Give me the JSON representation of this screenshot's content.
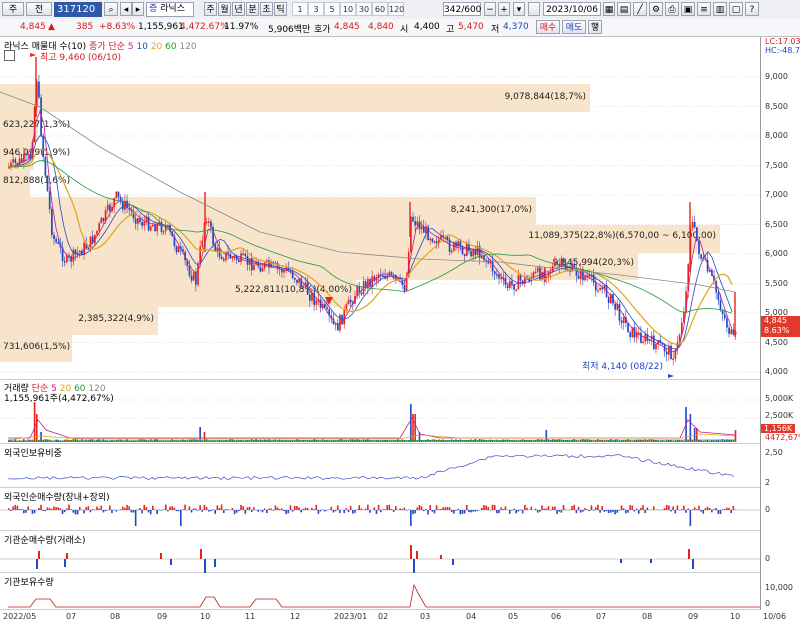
{
  "toolbar": {
    "market": "주",
    "segment": "전",
    "code": "317120",
    "name_tag": "증",
    "name": "라닉스",
    "periods": [
      "주",
      "월",
      "년",
      "분",
      "초",
      "틱"
    ],
    "intervals": [
      "1",
      "3",
      "5",
      "10",
      "30",
      "60",
      "120"
    ],
    "counter": "342",
    "counter_max": "600",
    "date": "2023/10/06"
  },
  "quote": {
    "price": "4,845",
    "change": "385",
    "change_pct": "+8.63%",
    "volume": "1,155,961",
    "volume_ratio": "4,472.67%",
    "turnover_pct": "11.97%",
    "amount": "5,906백만",
    "ask_label": "호가",
    "ask": "4,845",
    "bid": "4,840",
    "open_label": "시",
    "open": "4,400",
    "high_label": "고",
    "high": "5,470",
    "low_label": "저",
    "low": "4,370",
    "buy_label": "매수",
    "sell_label": "매도",
    "extra_label": "햏"
  },
  "price_panel": {
    "title": "라닉스 매물대 수(10)",
    "ma_label": "종가 단순",
    "ma_periods": [
      "5",
      "10",
      "20",
      "60",
      "120"
    ],
    "ma_colors": [
      "#c21e8a",
      "#2348c8",
      "#e0a41c",
      "#1e9a3a",
      "#8a8a8a"
    ],
    "high_note": "최고 9,460 (06/10)",
    "low_note": "최저 4,140 (08/22)",
    "lc_label": "LC:17.03",
    "hc_label": "HC:-48.78",
    "last_price": "4,845",
    "last_pct": "8.63%",
    "y_labels": [
      "9,000",
      "8,500",
      "8,000",
      "7,500",
      "7,000",
      "6,500",
      "6,000",
      "5,500",
      "5,000",
      "4,500",
      "4,000"
    ],
    "volume_profile": [
      {
        "text": "9,078,844(18,7%)"
      },
      {
        "text": "623,227(1,3%)"
      },
      {
        "text": "946,099(1,9%)"
      },
      {
        "text": "812,888(1,6%)"
      },
      {
        "text": "8,241,300(17,0%)"
      },
      {
        "text": "11,089,375(22,8%)(6,570,00 ~ 6,100,00)"
      },
      {
        "text": "9,845,994(20,3%)"
      },
      {
        "text": "5,222,811(10,8%)(4,00%)"
      },
      {
        "text": "2,385,322(4,9%)"
      },
      {
        "text": "731,606(1,5%)"
      }
    ]
  },
  "volume_panel": {
    "title": "거래량",
    "ma_label": "단순",
    "ma_periods": [
      "5",
      "20",
      "60",
      "120"
    ],
    "value_text": "1,155,961주(4,472,67%)",
    "y_labels": [
      "5,000K",
      "2,500K"
    ],
    "last_value": "1,156K",
    "last_pct": "4472,67%"
  },
  "foreign_ratio_panel": {
    "title": "외국인보유비중",
    "y_labels": [
      "2,50",
      "2"
    ]
  },
  "foreign_net_panel": {
    "title": "외국인순매수량(장내+장외)",
    "y_labels": [
      "0"
    ]
  },
  "inst_net_panel": {
    "title": "기관순매수량(거래소)",
    "y_labels": [
      "0"
    ]
  },
  "inst_hold_panel": {
    "title": "기관보유수량",
    "y_labels": [
      "10,000",
      "0"
    ]
  },
  "x_labels": [
    "2022/05",
    "07",
    "08",
    "09",
    "10",
    "11",
    "12",
    "2023/01",
    "02",
    "03",
    "04",
    "05",
    "06",
    "07",
    "08",
    "09",
    "10",
    "10/06"
  ]
}
